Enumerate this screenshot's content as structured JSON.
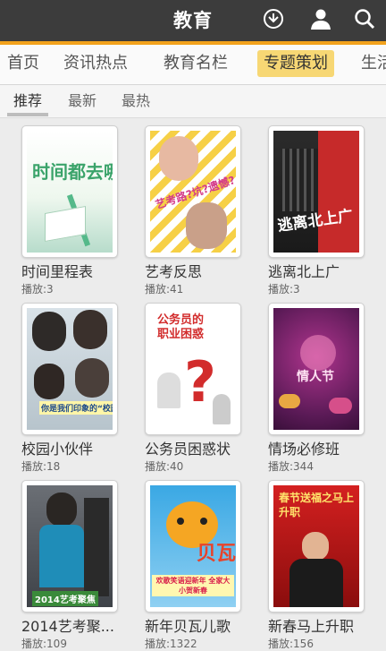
{
  "header": {
    "title": "教育",
    "icons": [
      "download-icon",
      "user-icon",
      "search-icon"
    ]
  },
  "nav": {
    "tabs": [
      "首页",
      "资讯热点",
      "教育名栏",
      "专题策划",
      "生活"
    ],
    "active": "专题策划"
  },
  "subnav": {
    "tabs": [
      "推荐",
      "最新",
      "最热"
    ],
    "active": "推荐"
  },
  "items": [
    {
      "title": "时间里程表",
      "plays": "播放:3",
      "poster_text": "时间都去哪儿了?"
    },
    {
      "title": "艺考反思",
      "plays": "播放:41",
      "poster_text": "艺考路?坑?遗憾?"
    },
    {
      "title": "逃离北上广",
      "plays": "播放:3",
      "poster_text": "逃离北上广"
    },
    {
      "title": "校园小伙伴",
      "plays": "播放:18",
      "poster_text": "你是我们印象的“校园小伙伴”"
    },
    {
      "title": "公务员困惑状",
      "plays": "播放:40",
      "poster_text": "公务员的职业困惑"
    },
    {
      "title": "情场必修班",
      "plays": "播放:344",
      "poster_text": "情人节"
    },
    {
      "title": "2014艺考聚...",
      "plays": "播放:109",
      "poster_text": "2014艺考聚焦"
    },
    {
      "title": "新年贝瓦儿歌",
      "plays": "播放:1322",
      "poster_text": "欢歌笑语迎新年 全家大小贺新春"
    },
    {
      "title": "新春马上升职",
      "plays": "播放:156",
      "poster_text": "春节送福之马上升职"
    }
  ],
  "colors": {
    "topbar": "#3c3c3c",
    "accent": "#f2a21c",
    "active_tab": "#f7d774"
  }
}
